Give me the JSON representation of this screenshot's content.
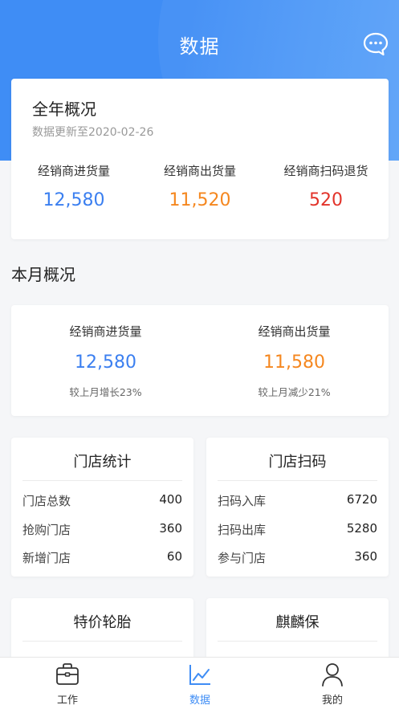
{
  "header": {
    "title": "数据",
    "message_icon": "chat-bubble-icon"
  },
  "year": {
    "title": "全年概况",
    "updated": "数据更新至2020-02-26",
    "stats": [
      {
        "label": "经销商进货量",
        "value": "12,580",
        "color": "#3b7ff0"
      },
      {
        "label": "经销商出货量",
        "value": "11,520",
        "color": "#f5871f"
      },
      {
        "label": "经销商扫码退货",
        "value": "520",
        "color": "#e2332a"
      }
    ]
  },
  "month": {
    "title": "本月概况",
    "stats": [
      {
        "label": "经销商进货量",
        "value": "12,580",
        "compare": "较上月增长23%",
        "color": "#3b7ff0"
      },
      {
        "label": "经销商出货量",
        "value": "11,580",
        "compare": "较上月减少21%",
        "color": "#f5871f"
      }
    ]
  },
  "store_stats": {
    "title": "门店统计",
    "rows": [
      {
        "label": "门店总数",
        "value": "400"
      },
      {
        "label": "抢购门店",
        "value": "360"
      },
      {
        "label": "新增门店",
        "value": "60"
      }
    ]
  },
  "store_scan": {
    "title": "门店扫码",
    "rows": [
      {
        "label": "扫码入库",
        "value": "6720"
      },
      {
        "label": "扫码出库",
        "value": "5280"
      },
      {
        "label": "参与门店",
        "value": "360"
      }
    ]
  },
  "special_tires": {
    "title": "特价轮胎"
  },
  "qilin": {
    "title": "麒麟保"
  },
  "tabbar": {
    "active": "data",
    "active_color": "#3f8df5",
    "tabs": [
      {
        "key": "work",
        "label": "工作",
        "icon": "briefcase-icon"
      },
      {
        "key": "data",
        "label": "数据",
        "icon": "line-chart-icon"
      },
      {
        "key": "me",
        "label": "我的",
        "icon": "person-icon"
      }
    ]
  }
}
